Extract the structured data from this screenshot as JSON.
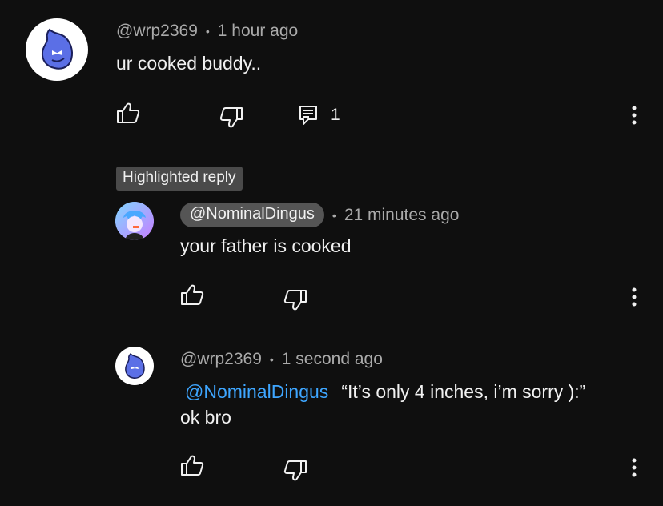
{
  "comment": {
    "author": "@wrp2369",
    "time": "1 hour ago",
    "text": "ur cooked buddy..",
    "reply_count": "1"
  },
  "highlighted_label": "Highlighted reply",
  "reply1": {
    "author": "@NominalDingus",
    "time": "21 minutes ago",
    "text": "your father is cooked"
  },
  "reply2": {
    "author": "@wrp2369",
    "time": "1 second ago",
    "mention": "@NominalDingus",
    "quote": "“It’s only 4 inches, i’m sorry ):”",
    "text2": "ok bro"
  },
  "separator": "•",
  "icons": {
    "like": "thumbs-up-icon",
    "dislike": "thumbs-down-icon",
    "reply": "reply-comment-icon",
    "more": "more-vertical-icon"
  },
  "colors": {
    "background": "#0f0f0f",
    "text": "#f1f1f1",
    "secondary": "#aaaaaa",
    "mention": "#3ea6ff",
    "badge": "#4a4a4a",
    "avatar_blue": "#4f63e0"
  }
}
